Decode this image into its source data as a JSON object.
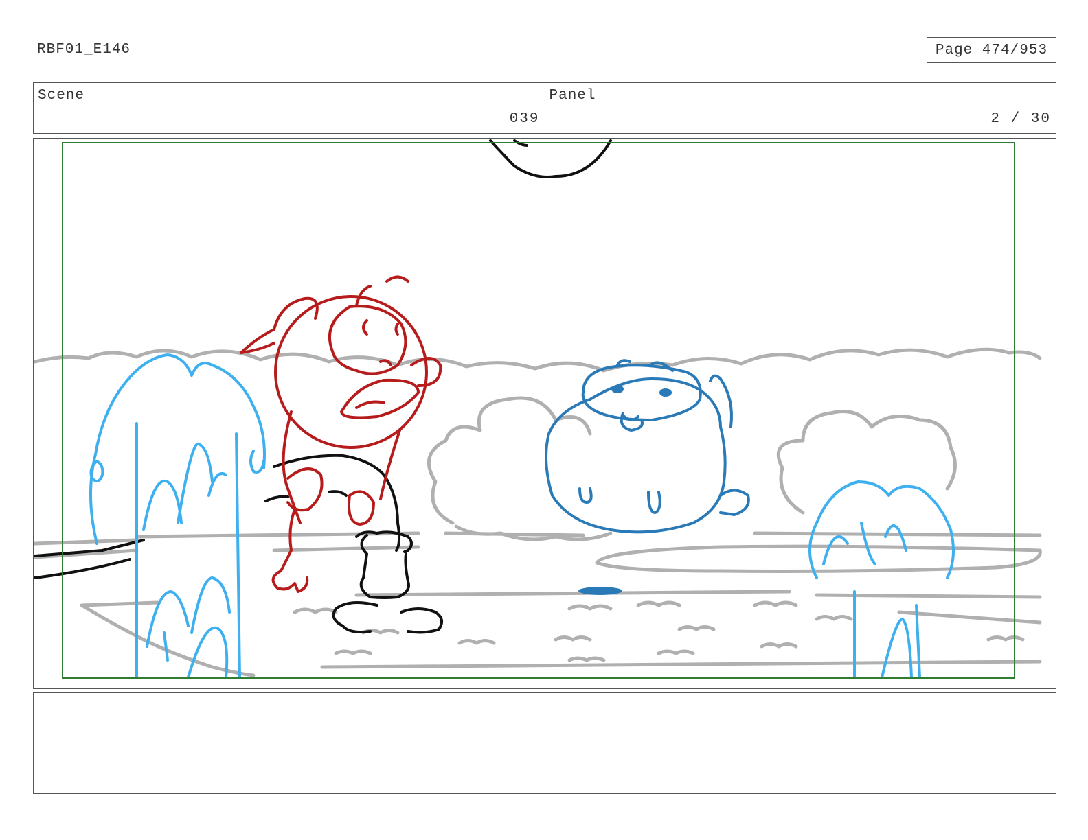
{
  "header": {
    "doc_id": "RBF01_E146",
    "page_label": "Page 474/953"
  },
  "info": {
    "scene_label": "Scene",
    "scene_value": "039",
    "panel_label": "Panel",
    "panel_value": "2 / 30"
  },
  "colors": {
    "safe_area": "#2e7d32",
    "background_sketch": "#b0b0b0",
    "red_character": "#b71c1c",
    "blue_character": "#2a7ab8",
    "water": "#3fb0ef",
    "ink": "#111111"
  },
  "notes": {
    "text": ""
  }
}
